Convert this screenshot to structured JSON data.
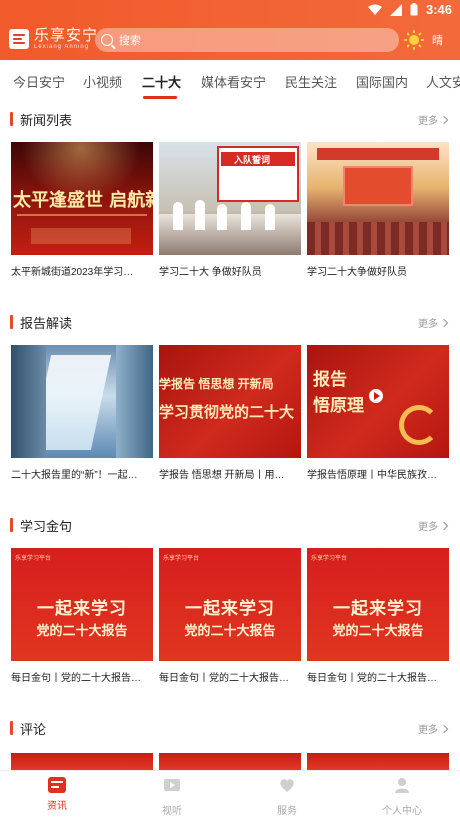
{
  "status_bar": {
    "time": "3:46"
  },
  "header": {
    "logo_text": "乐享安宁",
    "logo_subtext": "Lexiang Anning",
    "search_placeholder": "搜索",
    "weather_text": "晴"
  },
  "tabs": [
    {
      "label": "今日安宁"
    },
    {
      "label": "小视频"
    },
    {
      "label": "二十大",
      "active": true
    },
    {
      "label": "媒体看安宁"
    },
    {
      "label": "民生关注"
    },
    {
      "label": "国际国内"
    },
    {
      "label": "人文安"
    }
  ],
  "sections": [
    {
      "title": "新闻列表",
      "more": "更多",
      "cards": [
        {
          "caption": "太平新城街道2023年学习…",
          "overlay": "太平逢盛世 启航新征程"
        },
        {
          "caption": "学习二十大  争做好队员",
          "overlay": "入队誓词"
        },
        {
          "caption": "学习二十大争做好队员",
          "overlay": ""
        }
      ]
    },
    {
      "title": "报告解读",
      "more": "更多",
      "cards": [
        {
          "caption": "二十大报告里的“新”！一起…",
          "overlay": ""
        },
        {
          "caption": "学报告 悟思想 开新局丨用…",
          "overlay": "学报告  悟思想  开新局",
          "overlay2": "学习贯彻党的二十大"
        },
        {
          "caption": "学报告悟原理丨中华民族孜…",
          "overlay": "报告",
          "overlay2": "悟原理"
        }
      ]
    },
    {
      "title": "学习金句",
      "more": "更多",
      "cards": [
        {
          "caption": "每日金句丨党的二十大报告…",
          "tag": "乐享学习平台",
          "line1": "一起来学习",
          "line2": "党的二十大报告"
        },
        {
          "caption": "每日金句丨党的二十大报告…",
          "tag": "乐享学习平台",
          "line1": "一起来学习",
          "line2": "党的二十大报告"
        },
        {
          "caption": "每日金句丨党的二十大报告…",
          "tag": "乐享学习平台",
          "line1": "一起来学习",
          "line2": "党的二十大报告"
        }
      ]
    },
    {
      "title": "评论",
      "more": "更多"
    }
  ],
  "bottom_nav": [
    {
      "label": "资讯",
      "active": true,
      "icon": "news-icon"
    },
    {
      "label": "视听",
      "icon": "video-icon"
    },
    {
      "label": "服务",
      "icon": "service-icon"
    },
    {
      "label": "个人中心",
      "icon": "person-icon"
    }
  ],
  "colors": {
    "header_bg": "#f15a2b",
    "accent_red": "#e3301e"
  }
}
